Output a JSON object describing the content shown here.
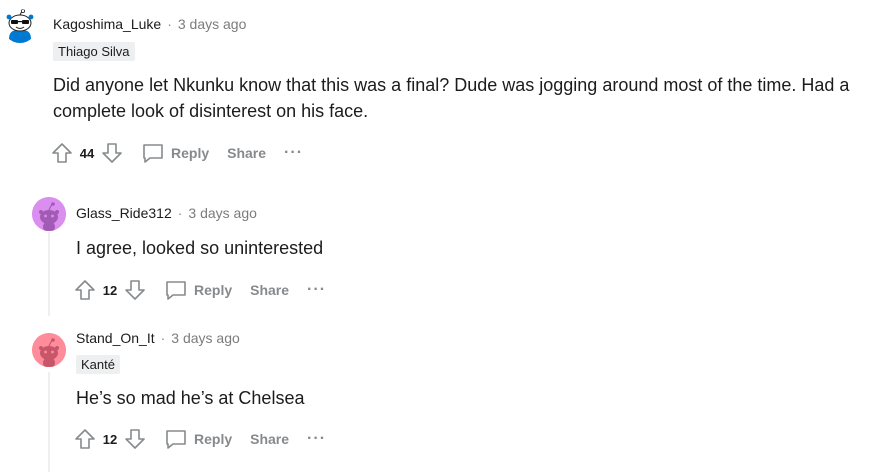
{
  "comments": [
    {
      "author": "Kagoshima_Luke",
      "time": "3 days ago",
      "flair": "Thiago Silva",
      "text": "Did anyone let Nkunku know that this was a final? Dude was jogging around most of the time. Had a complete look of disinterest on his face.",
      "score": "44",
      "reply_label": "Reply",
      "share_label": "Share",
      "avatar_color": "#0079d3"
    },
    {
      "author": "Glass_Ride312",
      "time": "3 days ago",
      "flair": "",
      "text": "I agree, looked so uninterested",
      "score": "12",
      "reply_label": "Reply",
      "share_label": "Share",
      "avatar_color": "#d98ef0"
    },
    {
      "author": "Stand_On_It",
      "time": "3 days ago",
      "flair": "Kanté",
      "text": "He’s so mad he’s at Chelsea",
      "score": "12",
      "reply_label": "Reply",
      "share_label": "Share",
      "avatar_color": "#ff8c9a"
    }
  ],
  "separator": "·",
  "more_label": "···"
}
